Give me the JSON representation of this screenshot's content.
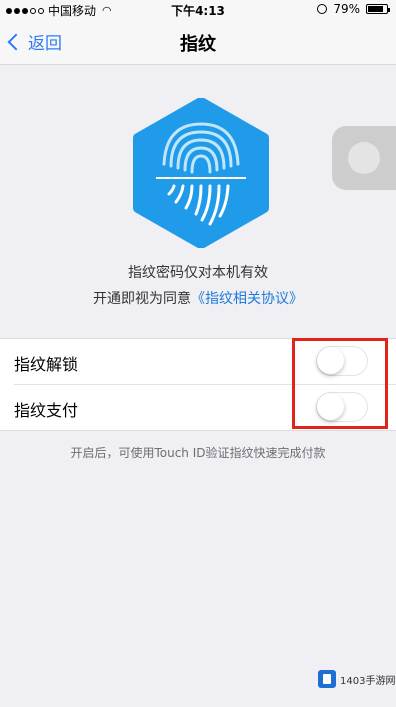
{
  "status_bar": {
    "carrier": "中国移动",
    "time": "下午4:13",
    "battery": "79%"
  },
  "nav": {
    "back_label": "返回",
    "title": "指纹"
  },
  "description": {
    "line1": "指纹密码仅对本机有效",
    "line2_prefix": "开通即视为同意",
    "agreement_link": "《指纹相关协议》"
  },
  "settings": {
    "rows": [
      {
        "label": "指纹解锁",
        "enabled": false
      },
      {
        "label": "指纹支付",
        "enabled": false
      }
    ]
  },
  "footer_note": "开启后，可使用Touch ID验证指纹快速完成付款",
  "watermark": {
    "text": "1403手游网"
  },
  "colors": {
    "accent": "#2d7cf6",
    "logo_blue": "#1f9bea",
    "highlight_red": "#e2231a",
    "background": "#efeff4"
  }
}
